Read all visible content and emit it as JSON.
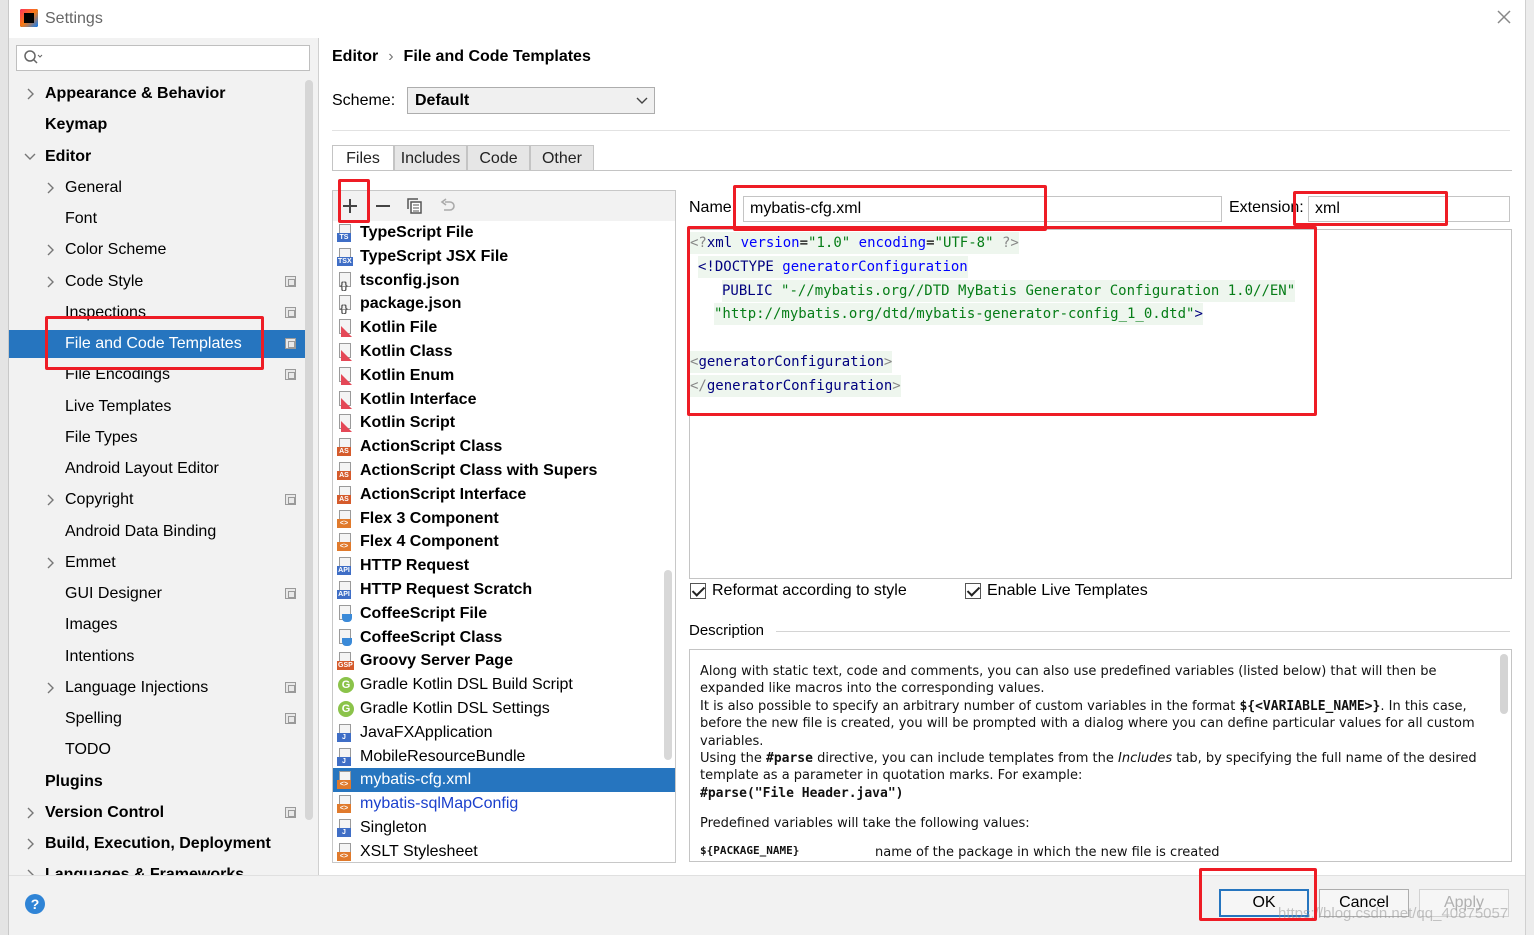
{
  "window": {
    "title": "Settings"
  },
  "sidebar": {
    "search_placeholder": "",
    "items": [
      {
        "label": "Appearance & Behavior",
        "bold": true,
        "arrow": "right",
        "indent": 0,
        "proj": false
      },
      {
        "label": "Keymap",
        "bold": true,
        "arrow": "",
        "indent": 0,
        "proj": false
      },
      {
        "label": "Editor",
        "bold": true,
        "arrow": "down",
        "indent": 0,
        "proj": false
      },
      {
        "label": "General",
        "bold": false,
        "arrow": "right",
        "indent": 1,
        "proj": false
      },
      {
        "label": "Font",
        "bold": false,
        "arrow": "",
        "indent": 1,
        "proj": false
      },
      {
        "label": "Color Scheme",
        "bold": false,
        "arrow": "right",
        "indent": 1,
        "proj": false
      },
      {
        "label": "Code Style",
        "bold": false,
        "arrow": "right",
        "indent": 1,
        "proj": true
      },
      {
        "label": "Inspections",
        "bold": false,
        "arrow": "",
        "indent": 1,
        "proj": true
      },
      {
        "label": "File and Code Templates",
        "bold": false,
        "arrow": "",
        "indent": 1,
        "proj": true,
        "selected": true
      },
      {
        "label": "File Encodings",
        "bold": false,
        "arrow": "",
        "indent": 1,
        "proj": true
      },
      {
        "label": "Live Templates",
        "bold": false,
        "arrow": "",
        "indent": 1,
        "proj": false
      },
      {
        "label": "File Types",
        "bold": false,
        "arrow": "",
        "indent": 1,
        "proj": false
      },
      {
        "label": "Android Layout Editor",
        "bold": false,
        "arrow": "",
        "indent": 1,
        "proj": false
      },
      {
        "label": "Copyright",
        "bold": false,
        "arrow": "right",
        "indent": 1,
        "proj": true
      },
      {
        "label": "Android Data Binding",
        "bold": false,
        "arrow": "",
        "indent": 1,
        "proj": false
      },
      {
        "label": "Emmet",
        "bold": false,
        "arrow": "right",
        "indent": 1,
        "proj": false
      },
      {
        "label": "GUI Designer",
        "bold": false,
        "arrow": "",
        "indent": 1,
        "proj": true
      },
      {
        "label": "Images",
        "bold": false,
        "arrow": "",
        "indent": 1,
        "proj": false
      },
      {
        "label": "Intentions",
        "bold": false,
        "arrow": "",
        "indent": 1,
        "proj": false
      },
      {
        "label": "Language Injections",
        "bold": false,
        "arrow": "right",
        "indent": 1,
        "proj": true
      },
      {
        "label": "Spelling",
        "bold": false,
        "arrow": "",
        "indent": 1,
        "proj": true
      },
      {
        "label": "TODO",
        "bold": false,
        "arrow": "",
        "indent": 1,
        "proj": false
      },
      {
        "label": "Plugins",
        "bold": true,
        "arrow": "",
        "indent": 0,
        "proj": false
      },
      {
        "label": "Version Control",
        "bold": true,
        "arrow": "right",
        "indent": 0,
        "proj": true
      },
      {
        "label": "Build, Execution, Deployment",
        "bold": true,
        "arrow": "right",
        "indent": 0,
        "proj": false
      },
      {
        "label": "Languages & Frameworks",
        "bold": true,
        "arrow": "right",
        "indent": 0,
        "proj": false
      }
    ]
  },
  "breadcrumb": {
    "parent": "Editor",
    "separator": "›",
    "current": "File and Code Templates"
  },
  "scheme": {
    "label": "Scheme:",
    "value": "Default"
  },
  "tabs": [
    {
      "label": "Files",
      "active": true
    },
    {
      "label": "Includes",
      "active": false
    },
    {
      "label": "Code",
      "active": false
    },
    {
      "label": "Other",
      "active": false
    }
  ],
  "templates": [
    {
      "label": "TypeScript File",
      "bold": true,
      "icon": "ts",
      "badge": "TS",
      "color": "#3f6ec6"
    },
    {
      "label": "TypeScript JSX File",
      "bold": true,
      "icon": "tsx",
      "badge": "TSX",
      "color": "#3f6ec6"
    },
    {
      "label": "tsconfig.json",
      "bold": true,
      "icon": "json",
      "badge": "",
      "color": ""
    },
    {
      "label": "package.json",
      "bold": true,
      "icon": "json",
      "badge": "",
      "color": ""
    },
    {
      "label": "Kotlin File",
      "bold": true,
      "icon": "kotlin",
      "badge": "",
      "color": ""
    },
    {
      "label": "Kotlin Class",
      "bold": true,
      "icon": "kotlin",
      "badge": "",
      "color": ""
    },
    {
      "label": "Kotlin Enum",
      "bold": true,
      "icon": "kotlin",
      "badge": "",
      "color": ""
    },
    {
      "label": "Kotlin Interface",
      "bold": true,
      "icon": "kotlin",
      "badge": "",
      "color": ""
    },
    {
      "label": "Kotlin Script",
      "bold": true,
      "icon": "kotlin",
      "badge": "",
      "color": ""
    },
    {
      "label": "ActionScript Class",
      "bold": true,
      "icon": "as",
      "badge": "AS",
      "color": "#d55b2c"
    },
    {
      "label": "ActionScript Class with Supers",
      "bold": true,
      "icon": "as",
      "badge": "AS",
      "color": "#d55b2c"
    },
    {
      "label": "ActionScript Interface",
      "bold": true,
      "icon": "as",
      "badge": "AS",
      "color": "#d55b2c"
    },
    {
      "label": "Flex 3 Component",
      "bold": true,
      "icon": "xml",
      "badge": "<>",
      "color": "#e07a2c"
    },
    {
      "label": "Flex 4 Component",
      "bold": true,
      "icon": "xml",
      "badge": "<>",
      "color": "#e07a2c"
    },
    {
      "label": "HTTP Request",
      "bold": true,
      "icon": "api",
      "badge": "API",
      "color": "#3f6ec6"
    },
    {
      "label": "HTTP Request Scratch",
      "bold": true,
      "icon": "api",
      "badge": "API",
      "color": "#3f6ec6"
    },
    {
      "label": "CoffeeScript File",
      "bold": true,
      "icon": "coffee",
      "badge": "",
      "color": ""
    },
    {
      "label": "CoffeeScript Class",
      "bold": true,
      "icon": "coffee",
      "badge": "",
      "color": ""
    },
    {
      "label": "Groovy Server Page",
      "bold": true,
      "icon": "gsp",
      "badge": "GSP",
      "color": "#d55b2c"
    },
    {
      "label": "Gradle Kotlin DSL Build Script",
      "bold": false,
      "icon": "gradle",
      "badge": "G",
      "color": ""
    },
    {
      "label": "Gradle Kotlin DSL Settings",
      "bold": false,
      "icon": "gradle",
      "badge": "G",
      "color": ""
    },
    {
      "label": "JavaFXApplication",
      "bold": false,
      "icon": "java",
      "badge": "J",
      "color": "#3f6ec6"
    },
    {
      "label": "MobileResourceBundle",
      "bold": false,
      "icon": "java",
      "badge": "J",
      "color": "#3f6ec6"
    },
    {
      "label": "mybatis-cfg.xml",
      "bold": false,
      "icon": "xml",
      "badge": "<>",
      "color": "#e07a2c",
      "selected": true
    },
    {
      "label": "mybatis-sqlMapConfig",
      "bold": false,
      "icon": "xml",
      "badge": "<>",
      "color": "#e07a2c",
      "blue": true
    },
    {
      "label": "Singleton",
      "bold": false,
      "icon": "java",
      "badge": "J",
      "color": "#3f6ec6"
    },
    {
      "label": "XSLT Stylesheet",
      "bold": false,
      "icon": "xml",
      "badge": "<>",
      "color": "#e07a2c"
    }
  ],
  "form": {
    "name_label": "Name:",
    "name_value": "mybatis-cfg.xml",
    "extension_label": "Extension:",
    "extension_value": "xml"
  },
  "code": {
    "xml_open": "<?",
    "xml_name": "xml",
    "version_attr": "version",
    "version_val": "\"1.0\"",
    "encoding_attr": "encoding",
    "encoding_val": "\"UTF-8\"",
    "xml_close": "?>",
    "doctype_open": "<!DOCTYPE",
    "doctype_name": "generatorConfiguration",
    "public_kw": "PUBLIC",
    "public_id": "\"-//mybatis.org//DTD MyBatis Generator Configuration 1.0//EN\"",
    "system_id": "\"http://mybatis.org/dtd/mybatis-generator-config_1_0.dtd\"",
    "doctype_close": ">",
    "lt": "<",
    "gt": ">",
    "lt_slash": "</",
    "root_tag": "generatorConfiguration"
  },
  "options": {
    "reformat_label": "Reformat according to style",
    "reformat_checked": true,
    "live_label": "Enable Live Templates",
    "live_checked": true
  },
  "description": {
    "label": "Description",
    "p1": "Along with static text, code and comments, you can also use predefined variables (listed below) that will then be expanded like macros into the corresponding values.",
    "p2_a": "It is also possible to specify an arbitrary number of custom variables in the format ",
    "p2_code": "${<VARIABLE_NAME>}",
    "p2_b": ". In this case, before the new file is created, you will be prompted with a dialog where you can define particular values for all custom variables.",
    "p3_a": "Using the ",
    "p3_code": "#parse",
    "p3_b": " directive, you can include templates from the ",
    "p3_em": "Includes",
    "p3_c": " tab, by specifying the full name of the desired template as a parameter in quotation marks. For example:",
    "p3_example": "#parse(\"File Header.java\")",
    "p4": "Predefined variables will take the following values:",
    "var_name": "${PACKAGE_NAME}",
    "var_desc": "name of the package in which the new file is created"
  },
  "footer": {
    "help": "?",
    "ok": "OK",
    "cancel": "Cancel",
    "apply": "Apply",
    "watermark": "https://blog.csdn.net/qq_40875057"
  },
  "colors": {
    "selection": "#2675bf",
    "annotation_red": "#ee1c25",
    "link_blue": "#1a3fcc"
  }
}
